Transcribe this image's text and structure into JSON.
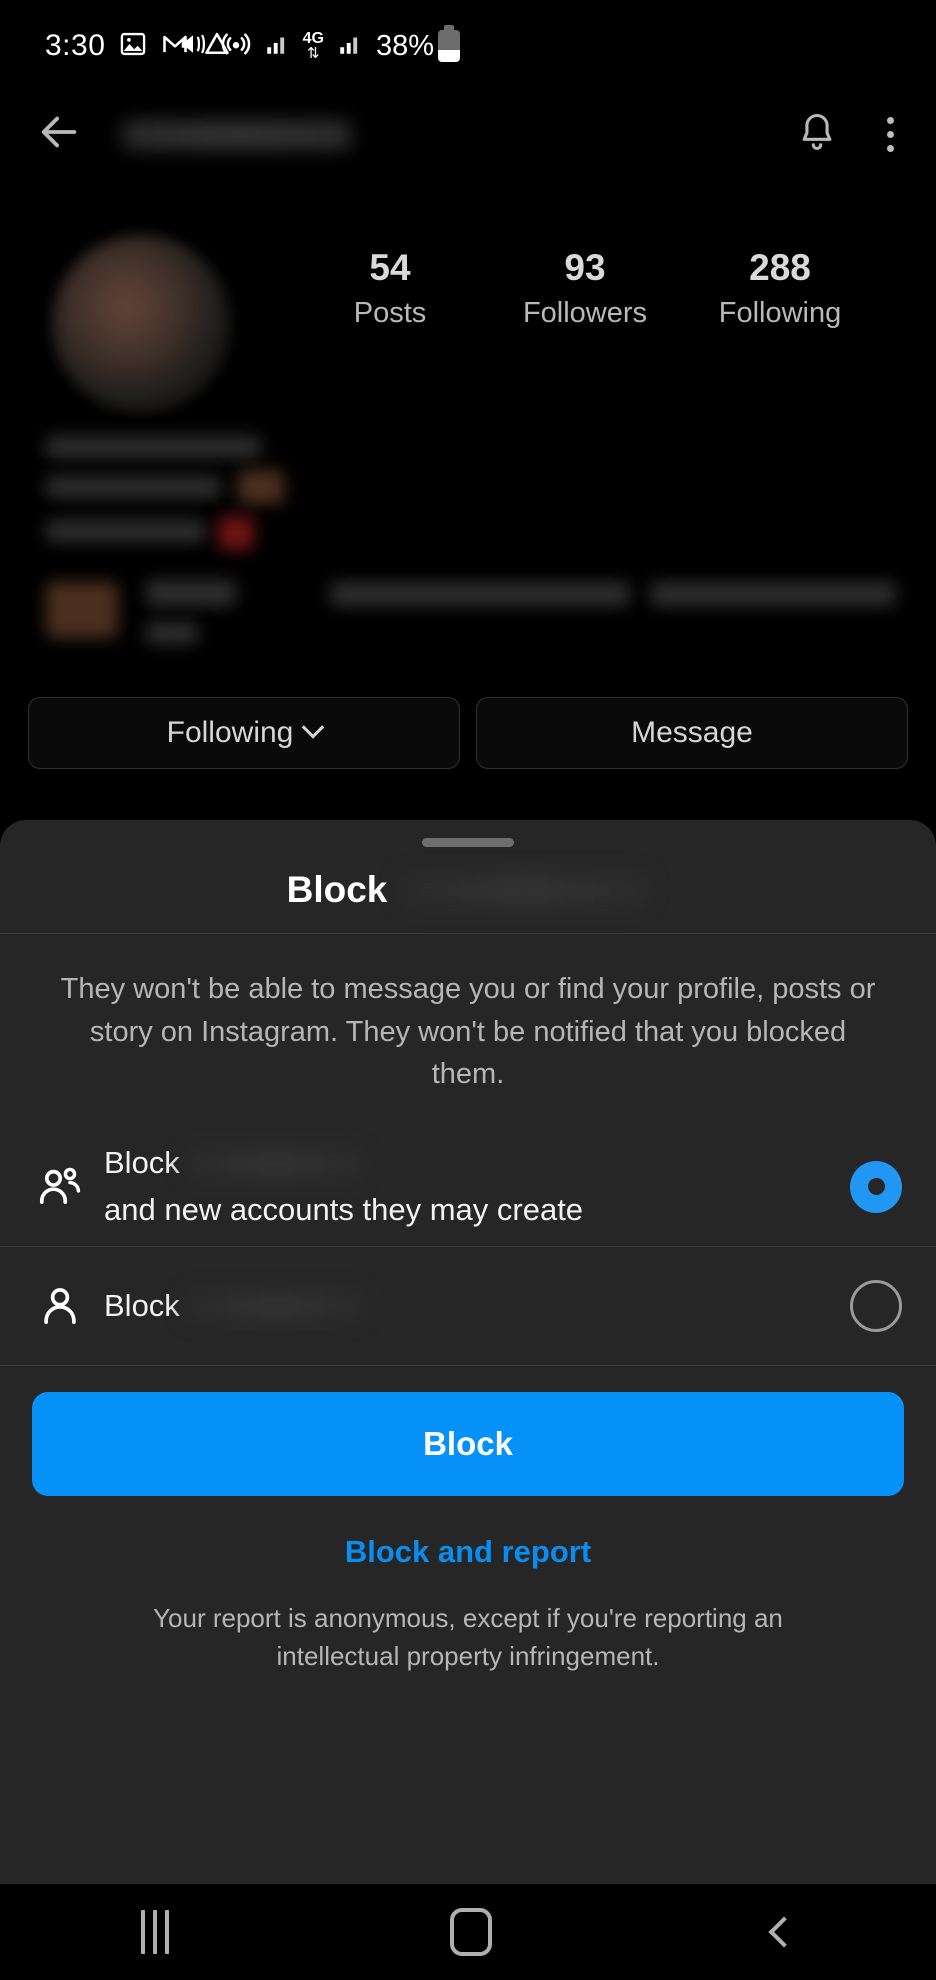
{
  "status_bar": {
    "time": "3:30",
    "battery_percent": "38%",
    "network_type": "4G",
    "icons": [
      "photos-icon",
      "gmail-icon",
      "drive-icon",
      "mute-icon",
      "hotspot-icon",
      "signal-bars-icon",
      "data-transfer-icon",
      "signal-bars-icon",
      "battery-icon"
    ]
  },
  "app_bar": {
    "back_label": "back-arrow",
    "username": "",
    "notifications_label": "notifications",
    "menu_label": "more-options"
  },
  "profile": {
    "stats": [
      {
        "count": "54",
        "label": "Posts"
      },
      {
        "count": "93",
        "label": "Followers"
      },
      {
        "count": "288",
        "label": "Following"
      }
    ],
    "buttons": {
      "following": "Following",
      "message": "Message"
    }
  },
  "sheet": {
    "title": "Block",
    "title_username": "",
    "description": "They won't be able to message you or find your profile, posts or story on Instagram. They won't be notified that you blocked them.",
    "options": [
      {
        "icon": "two-people-icon",
        "text_before": "Block",
        "text_after": "and new accounts they may create",
        "selected": true
      },
      {
        "icon": "person-icon",
        "text_before": "Block",
        "text_after": "",
        "selected": false
      }
    ],
    "primary_button": "Block",
    "secondary_link": "Block and report",
    "fineprint": "Your report is anonymous, except if you're reporting an intellectual property infringement."
  },
  "nav_bar": {
    "recents": "recents",
    "home": "home",
    "back": "back"
  },
  "colors": {
    "accent_blue": "#0591f7",
    "link_blue": "#0a8df0",
    "radio_blue": "#2196f3",
    "sheet_bg": "#262626",
    "page_bg": "#000000"
  }
}
